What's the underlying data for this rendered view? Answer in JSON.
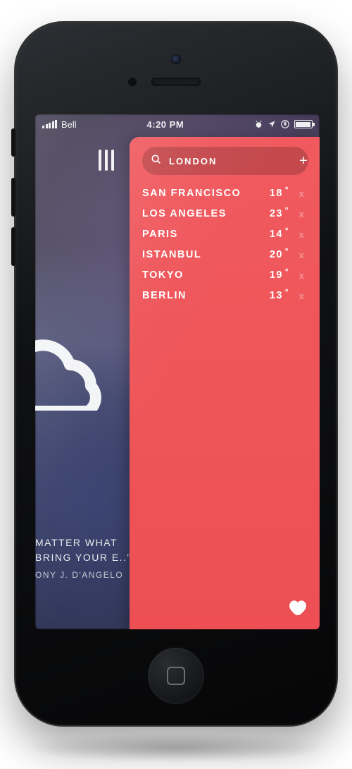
{
  "statusbar": {
    "carrier": "Bell",
    "time": "4:20 PM"
  },
  "search": {
    "value": "LONDON"
  },
  "cities": [
    {
      "name": "SAN FRANCISCO",
      "temp": "18"
    },
    {
      "name": "LOS ANGELES",
      "temp": "23"
    },
    {
      "name": "PARIS",
      "temp": "14"
    },
    {
      "name": "ISTANBUL",
      "temp": "20"
    },
    {
      "name": "TOKYO",
      "temp": "19"
    },
    {
      "name": "BERLIN",
      "temp": "13"
    }
  ],
  "quote": {
    "text": "MATTER WHAT BRING YOUR E..\"",
    "author": "ONY J. D'ANGELO"
  }
}
